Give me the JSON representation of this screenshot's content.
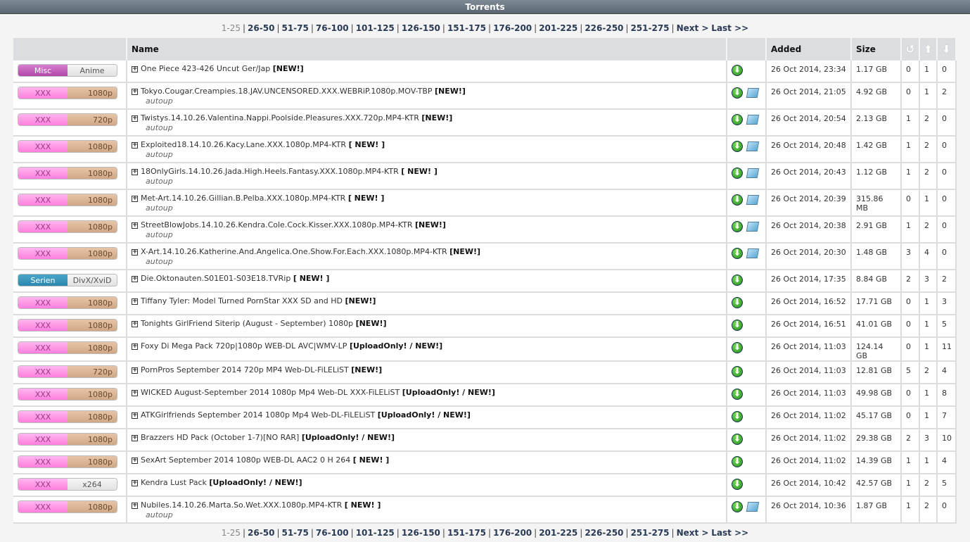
{
  "header": {
    "title": "Torrents"
  },
  "pager": {
    "current": "1-25",
    "pages": [
      "26-50",
      "51-75",
      "76-100",
      "101-125",
      "126-150",
      "151-175",
      "176-200",
      "201-225",
      "226-250",
      "251-275"
    ],
    "next": "Next >",
    "last": "Last >>"
  },
  "columns": {
    "name": "Name",
    "added": "Added",
    "size": "Size",
    "refresh_icon": "refresh-icon",
    "seed_icon": "arrow-up-icon",
    "leech_icon": "arrow-down-icon"
  },
  "rows": [
    {
      "cat1": "Misc",
      "cat1_color": "purple",
      "cat2": "Anime",
      "cat2_color": "grey",
      "name": "One Piece 423-426 Uncut Ger/Jap",
      "flag": "[NEW!]",
      "autoup": "",
      "nfo": false,
      "added": "26 Oct 2014, 23:34",
      "size": "1.17 GB",
      "c": "0",
      "s": "1",
      "l": "0"
    },
    {
      "cat1": "XXX",
      "cat1_color": "pink",
      "cat2": "1080p",
      "cat2_color": "tan",
      "name": "Tokyo.Cougar.Creampies.18.JAV.UNCENSORED.XXX.WEBRiP.1080p.MOV-TBP",
      "flag": "[NEW!]",
      "autoup": "autoup",
      "nfo": true,
      "added": "26 Oct 2014, 21:05",
      "size": "4.92 GB",
      "c": "0",
      "s": "1",
      "l": "2"
    },
    {
      "cat1": "XXX",
      "cat1_color": "pink",
      "cat2": "720p",
      "cat2_color": "tan",
      "name": "Twistys.14.10.26.Valentina.Nappi.Poolside.Pleasures.XXX.720p.MP4-KTR",
      "flag": "[NEW!]",
      "autoup": "autoup",
      "nfo": true,
      "added": "26 Oct 2014, 20:54",
      "size": "2.13 GB",
      "c": "1",
      "s": "2",
      "l": "0"
    },
    {
      "cat1": "XXX",
      "cat1_color": "pink",
      "cat2": "1080p",
      "cat2_color": "tan",
      "name": "Exploited18.14.10.26.Kacy.Lane.XXX.1080p.MP4-KTR",
      "flag": "[ NEW! ]",
      "autoup": "autoup",
      "nfo": true,
      "added": "26 Oct 2014, 20:48",
      "size": "1.42 GB",
      "c": "1",
      "s": "2",
      "l": "0"
    },
    {
      "cat1": "XXX",
      "cat1_color": "pink",
      "cat2": "1080p",
      "cat2_color": "tan",
      "name": "18OnlyGirls.14.10.26.Jada.High.Heels.Fantasy.XXX.1080p.MP4-KTR",
      "flag": "[ NEW! ]",
      "autoup": "autoup",
      "nfo": true,
      "added": "26 Oct 2014, 20:43",
      "size": "1.12 GB",
      "c": "1",
      "s": "2",
      "l": "0"
    },
    {
      "cat1": "XXX",
      "cat1_color": "pink",
      "cat2": "1080p",
      "cat2_color": "tan",
      "name": "Met-Art.14.10.26.Gillian.B.Pelba.XXX.1080p.MP4-KTR",
      "flag": "[ NEW! ]",
      "autoup": "autoup",
      "nfo": true,
      "added": "26 Oct 2014, 20:39",
      "size": "315.86 MB",
      "c": "0",
      "s": "1",
      "l": "0"
    },
    {
      "cat1": "XXX",
      "cat1_color": "pink",
      "cat2": "1080p",
      "cat2_color": "tan",
      "name": "StreetBlowJobs.14.10.26.Kendra.Cole.Cock.Kisser.XXX.1080p.MP4-KTR",
      "flag": "[NEW!]",
      "autoup": "autoup",
      "nfo": true,
      "added": "26 Oct 2014, 20:38",
      "size": "2.91 GB",
      "c": "1",
      "s": "2",
      "l": "0"
    },
    {
      "cat1": "XXX",
      "cat1_color": "pink",
      "cat2": "1080p",
      "cat2_color": "tan",
      "name": "X-Art.14.10.26.Katherine.And.Angelica.One.Show.For.Each.XXX.1080p.MP4-KTR",
      "flag": "[NEW!]",
      "autoup": "autoup",
      "nfo": true,
      "added": "26 Oct 2014, 20:30",
      "size": "1.48 GB",
      "c": "3",
      "s": "4",
      "l": "0"
    },
    {
      "cat1": "Serien",
      "cat1_color": "blue",
      "cat2": "DivX/XviD",
      "cat2_color": "grey",
      "name": "Die.Oktonauten.S01E01-S03E18.TVRip",
      "flag": "[ NEW! ]",
      "autoup": "",
      "nfo": false,
      "added": "26 Oct 2014, 17:35",
      "size": "8.84 GB",
      "c": "2",
      "s": "3",
      "l": "2"
    },
    {
      "cat1": "XXX",
      "cat1_color": "pink",
      "cat2": "1080p",
      "cat2_color": "tan",
      "name": "Tiffany Tyler: Model Turned PornStar XXX SD and HD",
      "flag": "[NEW!]",
      "autoup": "",
      "nfo": false,
      "added": "26 Oct 2014, 16:52",
      "size": "17.71 GB",
      "c": "0",
      "s": "1",
      "l": "3"
    },
    {
      "cat1": "XXX",
      "cat1_color": "pink",
      "cat2": "1080p",
      "cat2_color": "tan",
      "name": "Tonights GirlFriend Siterip (August - September) 1080p",
      "flag": "[NEW!]",
      "autoup": "",
      "nfo": false,
      "added": "26 Oct 2014, 16:51",
      "size": "41.01 GB",
      "c": "0",
      "s": "1",
      "l": "5"
    },
    {
      "cat1": "XXX",
      "cat1_color": "pink",
      "cat2": "1080p",
      "cat2_color": "tan",
      "name": "Foxy Di Mega Pack 720p|1080p WEB-DL AVC|WMV-LP",
      "flag": "[UploadOnly! / NEW!]",
      "autoup": "",
      "nfo": false,
      "added": "26 Oct 2014, 11:03",
      "size": "124.14 GB",
      "c": "0",
      "s": "1",
      "l": "11"
    },
    {
      "cat1": "XXX",
      "cat1_color": "pink",
      "cat2": "720p",
      "cat2_color": "tan",
      "name": "PornPros September 2014 720p MP4 Web-DL-FiLELiST",
      "flag": "[NEW!]",
      "autoup": "",
      "nfo": false,
      "added": "26 Oct 2014, 11:03",
      "size": "12.81 GB",
      "c": "5",
      "s": "2",
      "l": "4"
    },
    {
      "cat1": "XXX",
      "cat1_color": "pink",
      "cat2": "1080p",
      "cat2_color": "tan",
      "name": "WICKED August-September 2014 1080p Mp4 Web-DL XXX-FiLELiST",
      "flag": "[UploadOnly! / NEW!]",
      "autoup": "",
      "nfo": false,
      "added": "26 Oct 2014, 11:03",
      "size": "49.98 GB",
      "c": "0",
      "s": "1",
      "l": "8"
    },
    {
      "cat1": "XXX",
      "cat1_color": "pink",
      "cat2": "1080p",
      "cat2_color": "tan",
      "name": "ATKGirlfriends September 2014 1080p Mp4 Web-DL-FiLELiST",
      "flag": "[UploadOnly! / NEW!]",
      "autoup": "",
      "nfo": false,
      "added": "26 Oct 2014, 11:02",
      "size": "45.17 GB",
      "c": "0",
      "s": "1",
      "l": "7"
    },
    {
      "cat1": "XXX",
      "cat1_color": "pink",
      "cat2": "1080p",
      "cat2_color": "tan",
      "name": "Brazzers HD Pack (October 1-7)[NO RAR]",
      "flag": "[UploadOnly! / NEW!]",
      "autoup": "",
      "nfo": false,
      "added": "26 Oct 2014, 11:02",
      "size": "29.38 GB",
      "c": "2",
      "s": "3",
      "l": "10"
    },
    {
      "cat1": "XXX",
      "cat1_color": "pink",
      "cat2": "1080p",
      "cat2_color": "tan",
      "name": "SexArt September 2014 1080p WEB-DL AAC2 0 H 264",
      "flag": "[ NEW! ]",
      "autoup": "",
      "nfo": false,
      "added": "26 Oct 2014, 11:02",
      "size": "14.39 GB",
      "c": "1",
      "s": "1",
      "l": "4"
    },
    {
      "cat1": "XXX",
      "cat1_color": "pink",
      "cat2": "x264",
      "cat2_color": "grey",
      "name": "Kendra Lust Pack",
      "flag": "[UploadOnly! / NEW!]",
      "autoup": "",
      "nfo": false,
      "added": "26 Oct 2014, 10:42",
      "size": "42.57 GB",
      "c": "1",
      "s": "2",
      "l": "5"
    },
    {
      "cat1": "XXX",
      "cat1_color": "pink",
      "cat2": "1080p",
      "cat2_color": "tan",
      "name": "Nubiles.14.10.26.Marta.So.Wet.XXX.1080p.MP4-KTR",
      "flag": "[ NEW! ]",
      "autoup": "autoup",
      "nfo": true,
      "added": "26 Oct 2014, 10:36",
      "size": "1.87 GB",
      "c": "1",
      "s": "2",
      "l": "0"
    }
  ]
}
